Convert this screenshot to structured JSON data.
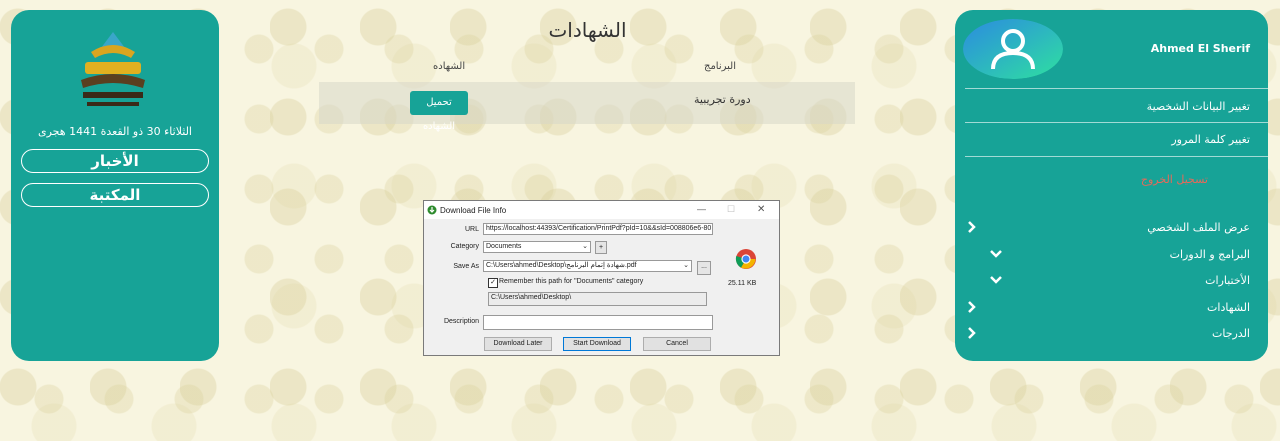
{
  "left_panel": {
    "hijri_date": "الثلاثاء 30 ذو القعدة 1441 هجرى",
    "news_label": "الأخبار",
    "library_label": "المكتبة"
  },
  "right_panel": {
    "username": "Ahmed El Sherif",
    "links": {
      "edit_profile": "تغيير البيانات الشخصية",
      "change_password": "تغيير كلمة المرور",
      "logout": "تسجيل الخروج"
    },
    "nav": [
      {
        "label": "عرض الملف الشخصي",
        "chevron": "right"
      },
      {
        "label": "البرامج و الدورات",
        "chevron": "down"
      },
      {
        "label": "الأختبارات",
        "chevron": "down"
      },
      {
        "label": "الشهادات",
        "chevron": "right"
      },
      {
        "label": "الدرجات",
        "chevron": "right"
      }
    ]
  },
  "main": {
    "title": "الشهادات",
    "columns": {
      "program": "البرنامج",
      "certificate": "الشهاده"
    },
    "rows": [
      {
        "program": "دورة تجريبية",
        "action": "تحميل الشهاده"
      }
    ]
  },
  "dialog": {
    "title": "Download File Info",
    "labels": {
      "url": "URL",
      "category": "Category",
      "save_as": "Save As",
      "description": "Description"
    },
    "url_value": "https://localhost:44393/Certification/PrintPdf?pId=10&&sId=008806e6-80",
    "category_value": "Documents",
    "save_as_value": "C:\\Users\\ahmed\\Desktop\\شهادة إتمام البرنامج.pdf",
    "remember_label": "Remember this path for \"Documents\" category",
    "remember_checked": true,
    "path_value": "C:\\Users\\ahmed\\Desktop\\",
    "description_value": "",
    "file_size": "25.11  KB",
    "plus_label": "+",
    "browse_label": "...",
    "buttons": {
      "later": "Download Later",
      "start": "Start Download",
      "cancel": "Cancel"
    }
  },
  "colors": {
    "teal": "#17a397",
    "logout_red": "#e46a5a"
  },
  "icons": [
    "user-avatar-icon",
    "academy-logo",
    "chevron-right-icon",
    "chevron-down-icon",
    "chrome-icon",
    "download-app-icon"
  ]
}
